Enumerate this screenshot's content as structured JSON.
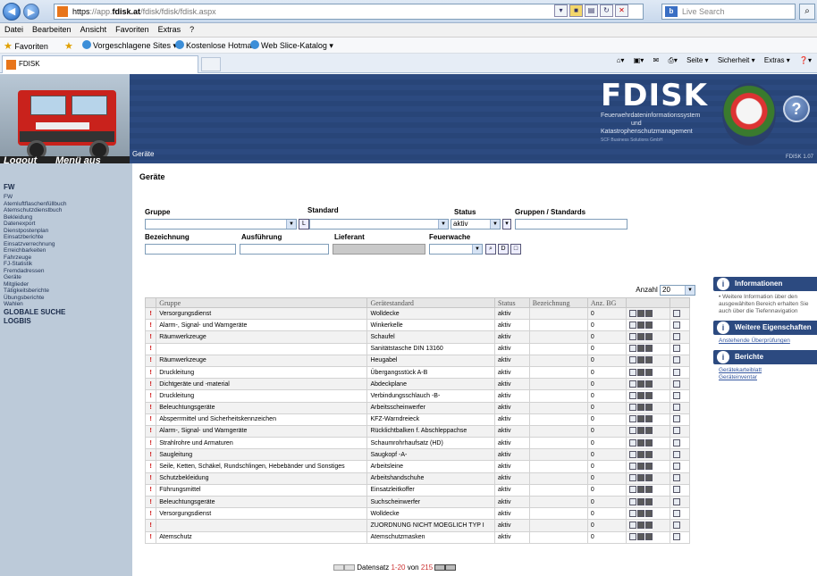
{
  "browser": {
    "url_prefix": "https",
    "url_dim1": "://app.",
    "url_host": "fdisk.at",
    "url_rest": "/fdisk/fdisk/fdisk.aspx",
    "search_placeholder": "Live Search",
    "search_logo": "b",
    "menu": [
      "Datei",
      "Bearbeiten",
      "Ansicht",
      "Favoriten",
      "Extras",
      "?"
    ],
    "favorites_label": "Favoriten",
    "fav_items": [
      "Vorgeschlagene Sites ▾",
      "Kostenlose Hotmail",
      "Web Slice-Katalog ▾"
    ],
    "tab_title": "FDISK",
    "commands": [
      "Seite ▾",
      "Sicherheit ▾",
      "Extras ▾"
    ]
  },
  "header": {
    "logout": "Logout",
    "menu_aus": "Menü aus",
    "crumb": "Geräte",
    "brand": "FDISK",
    "brand_sub1": "Feuerwehrdateninformationssystem",
    "brand_sub2": "und",
    "brand_sub3": "Katastrophenschutzmanagement",
    "brand_small": "SCF Business Solutions GmbH",
    "help": "?",
    "version": "FDISK 1.07"
  },
  "nav": {
    "head": "FW",
    "items": [
      "FW",
      "Atemluftflaschenfüllbuch",
      "Atemschutzdienstbuch",
      "Bekleidung",
      "Datenexport",
      "Dienstpostenplan",
      "Einsatzberichte",
      "Einsatzverrechnung",
      "Erreichbarkeiten",
      "Fahrzeuge",
      "FJ-Statistik",
      "Fremdadressen",
      "Geräte",
      "Mitglieder",
      "Tätigkeitsberichte",
      "Übungsberichte",
      "Wahlen"
    ],
    "bold_items": [
      "GLOBALE SUCHE",
      "LOGBIS"
    ]
  },
  "main": {
    "title": "Geräte",
    "filters": {
      "gruppe_label": "Gruppe",
      "standard_label": "Standard",
      "status_label": "Status",
      "status_value": "aktiv",
      "gruppen_standards_label": "Gruppen / Standards",
      "bezeichnung_label": "Bezeichnung",
      "ausfuehrung_label": "Ausführung",
      "lieferant_label": "Lieferant",
      "feuerwache_label": "Feuerwache"
    },
    "anzahl_label": "Anzahl",
    "anzahl_value": "20",
    "columns": [
      "",
      "Gruppe",
      "Gerätestandard",
      "Status",
      "Bezeichnung",
      "Anz. BG",
      "",
      ""
    ],
    "rows": [
      [
        "Versorgungsdienst",
        "Wolldecke",
        "aktiv",
        "",
        "0"
      ],
      [
        "Alarm-, Signal- und Warngeräte",
        "Winkerkelle",
        "aktiv",
        "",
        "0"
      ],
      [
        "Räumwerkzeuge",
        "Schaufel",
        "aktiv",
        "",
        "0"
      ],
      [
        "",
        "Sanitätstasche DIN 13160",
        "aktiv",
        "",
        "0"
      ],
      [
        "Räumwerkzeuge",
        "Heugabel",
        "aktiv",
        "",
        "0"
      ],
      [
        "Druckleitung",
        "Übergangsstück A-B",
        "aktiv",
        "",
        "0"
      ],
      [
        "Dichtgeräte und -material",
        "Abdeckplane",
        "aktiv",
        "",
        "0"
      ],
      [
        "Druckleitung",
        "Verbindungsschlauch -B-",
        "aktiv",
        "",
        "0"
      ],
      [
        "Beleuchtungsgeräte",
        "Arbeitsscheinwerfer",
        "aktiv",
        "",
        "0"
      ],
      [
        "Absperrmittel und Sicherheitskennzeichen",
        "KFZ-Warndreieck",
        "aktiv",
        "",
        "0"
      ],
      [
        "Alarm-, Signal- und Warngeräte",
        "Rücklichtbalken f. Abschleppachse",
        "aktiv",
        "",
        "0"
      ],
      [
        "Strahlrohre und Armaturen",
        "Schaumrohrhaufsatz (HD)",
        "aktiv",
        "",
        "0"
      ],
      [
        "Saugleitung",
        "Saugkopf -A-",
        "aktiv",
        "",
        "0"
      ],
      [
        "Seile, Ketten, Schäkel, Rundschlingen, Hebebänder und Sonstiges",
        "Arbeitsleine",
        "aktiv",
        "",
        "0"
      ],
      [
        "Schutzbekleidung",
        "Arbeitshandschuhe",
        "aktiv",
        "",
        "0"
      ],
      [
        "Führungsmittel",
        "Einsatzleitkoffer",
        "aktiv",
        "",
        "0"
      ],
      [
        "Beleuchtungsgeräte",
        "Suchscheinwerfer",
        "aktiv",
        "",
        "0"
      ],
      [
        "Versorgungsdienst",
        "Wolldecke",
        "aktiv",
        "",
        "0"
      ],
      [
        "",
        "ZUORDNUNG NICHT MOEGLICH TYP I",
        "aktiv",
        "",
        "0"
      ],
      [
        "Atemschutz",
        "Atemschutzmasken",
        "aktiv",
        "",
        "0"
      ]
    ],
    "warn_mark": "!",
    "pager": {
      "prefix": "Datensatz ",
      "range": "1-20",
      "mid": " von ",
      "total": "215"
    }
  },
  "right": {
    "info_title": "Informationen",
    "info_text": "Weitere Information über den ausgewählten Bereich erhalten Sie auch über die Tiefennavigation",
    "props_title": "Weitere Eigenschaften",
    "props_link": "Anstehende Überprüfungen",
    "reports_title": "Berichte",
    "reports_links": [
      "Gerätekarteiblatt",
      "Geräteinventar"
    ]
  }
}
